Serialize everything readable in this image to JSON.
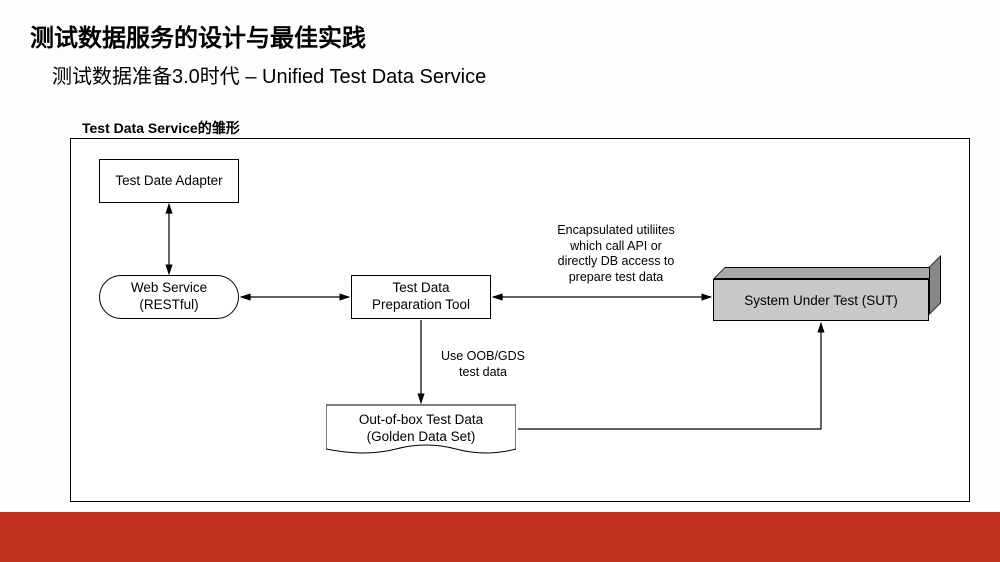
{
  "title": "测试数据服务的设计与最佳实践",
  "subtitle": "测试数据准备3.0时代 – Unified Test Data Service",
  "diagram_title": "Test Data Service的雏形",
  "nodes": {
    "adapter": "Test Date Adapter",
    "webservice": "Web Service\n(RESTful)",
    "preptool": "Test Data\nPreparation Tool",
    "oob": "Out-of-box Test Data\n(Golden Data Set)",
    "sut": "System Under Test (SUT)"
  },
  "annotations": {
    "encapsulated": "Encapsulated utiliites\nwhich call API or\ndirectly DB access to\nprepare test data",
    "use_oob": "Use OOB/GDS\ntest data"
  },
  "footer_color": "#c1301c"
}
